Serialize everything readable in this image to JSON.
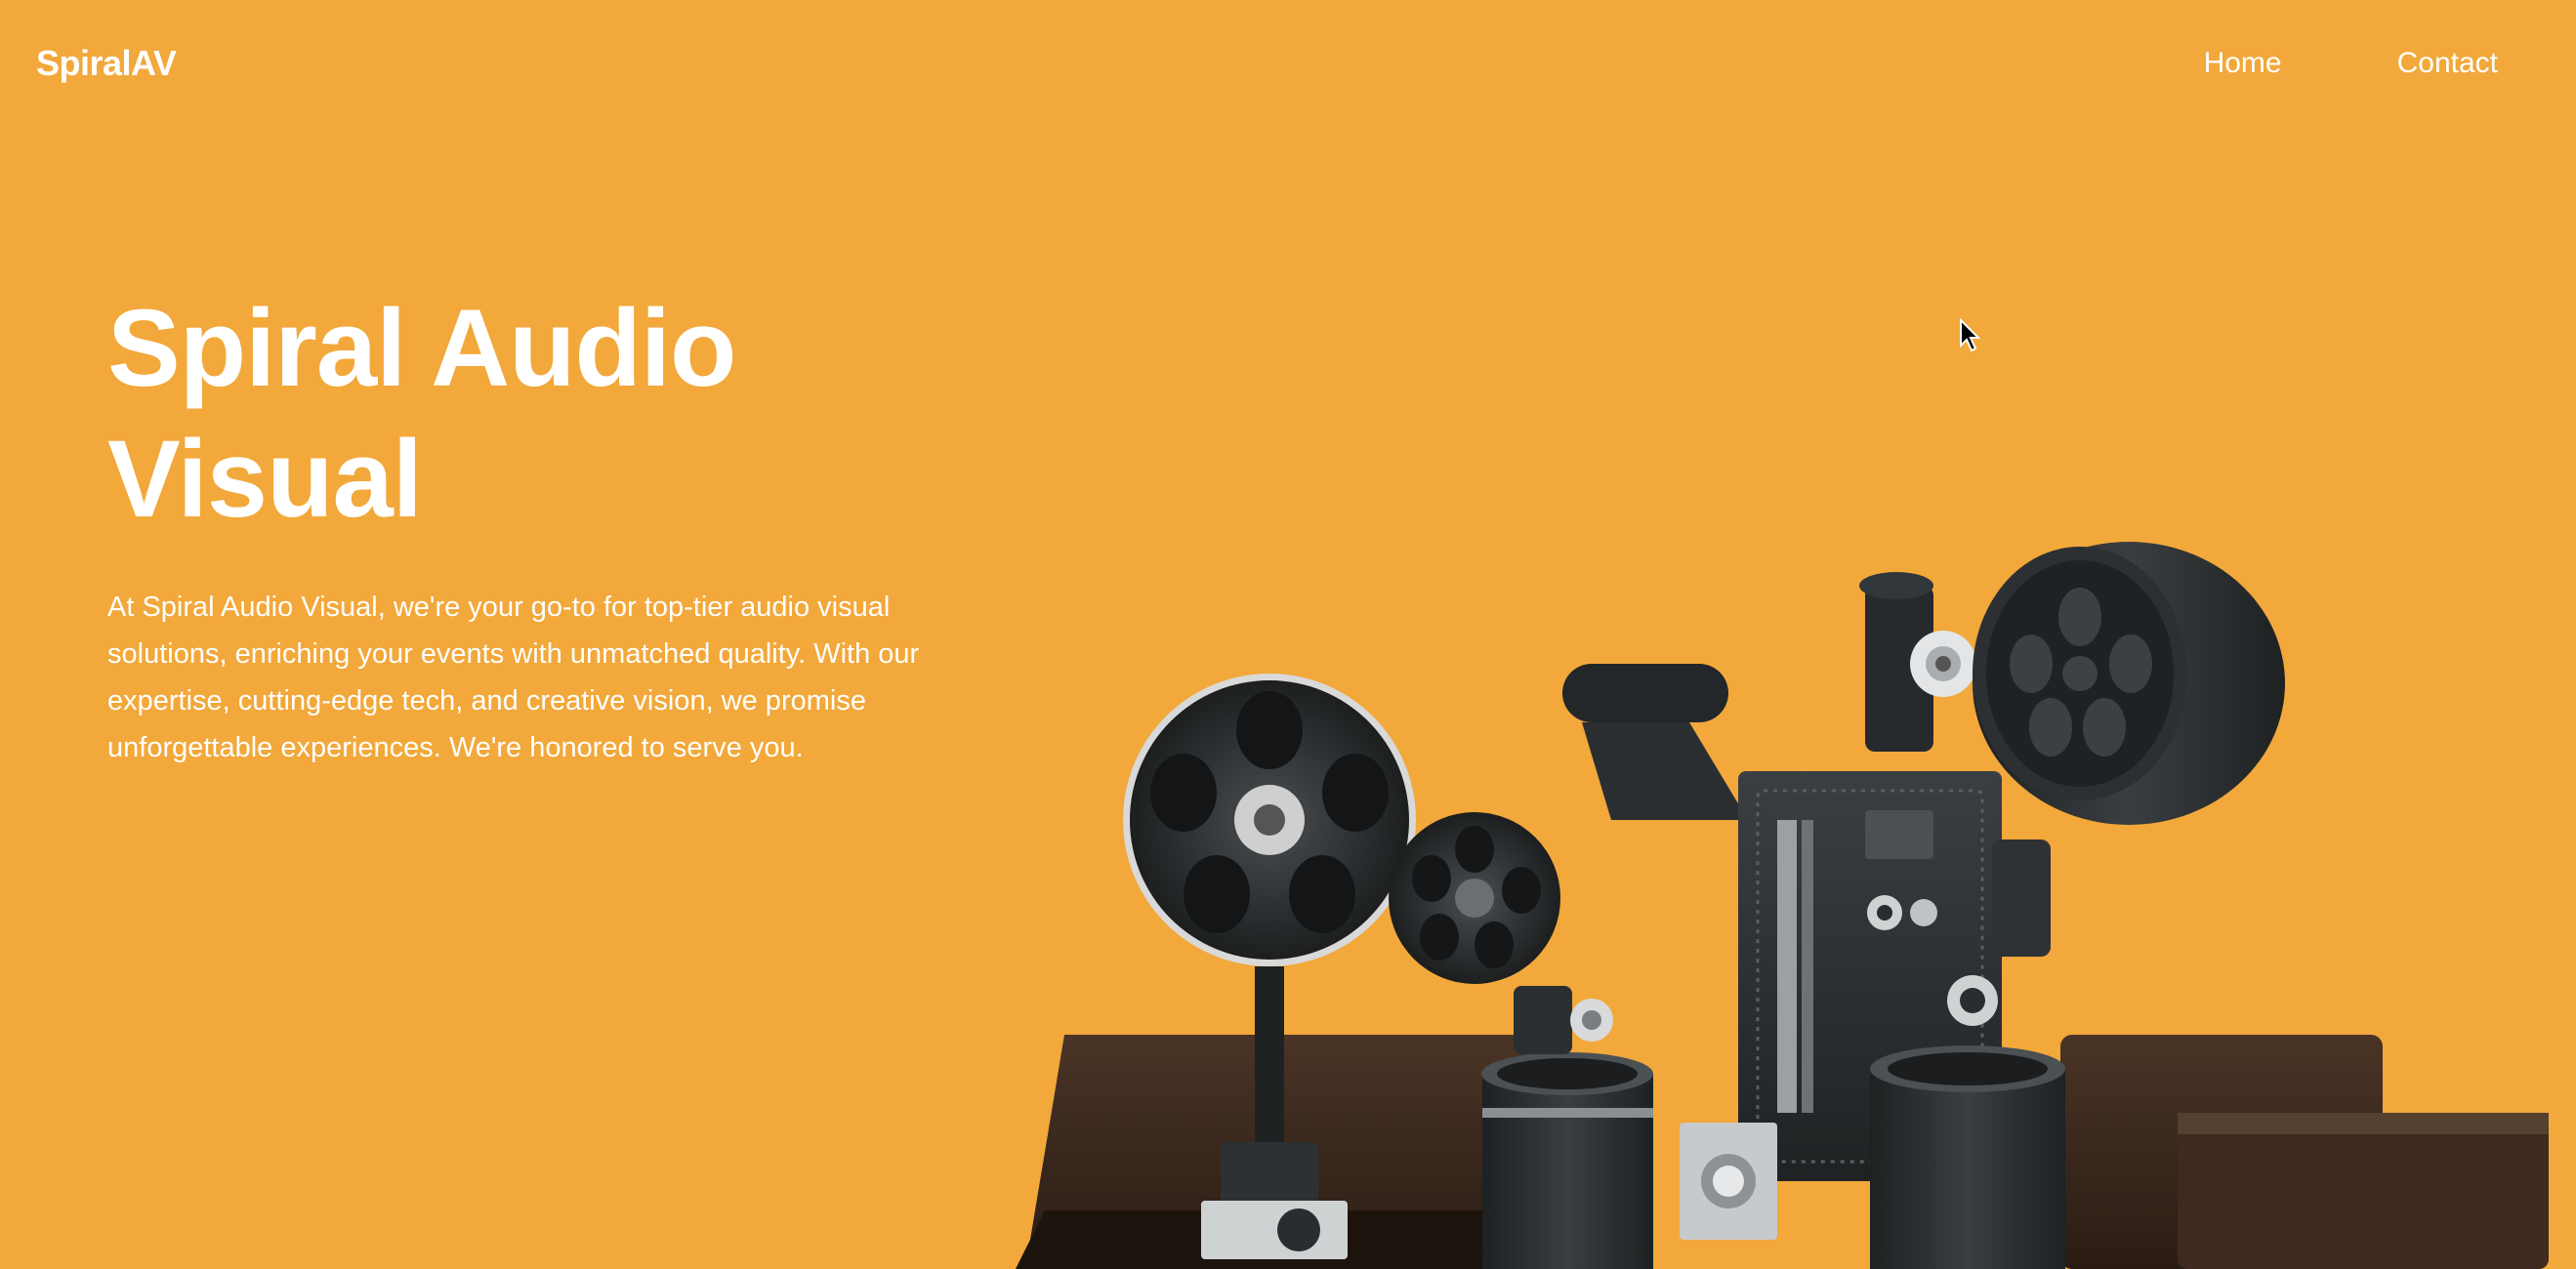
{
  "header": {
    "brand": "SpiralAV",
    "nav": [
      {
        "label": "Home"
      },
      {
        "label": "Contact"
      }
    ]
  },
  "hero": {
    "title": "Spiral Audio Visual",
    "description": "At Spiral Audio Visual, we're your go-to for top-tier audio visual solutions, enriching your events with unmatched quality. With our expertise, cutting-edge tech, and creative vision, we promise unforgettable experiences. We're honored to serve you."
  },
  "icons": {
    "illustration": "film-projector-illustration",
    "cursor": "mouse-pointer-icon"
  },
  "colors": {
    "background": "#F2A83A",
    "text": "#FFFFFF",
    "equipment_dark": "#2B2E30",
    "equipment_brown": "#3A2A20"
  }
}
